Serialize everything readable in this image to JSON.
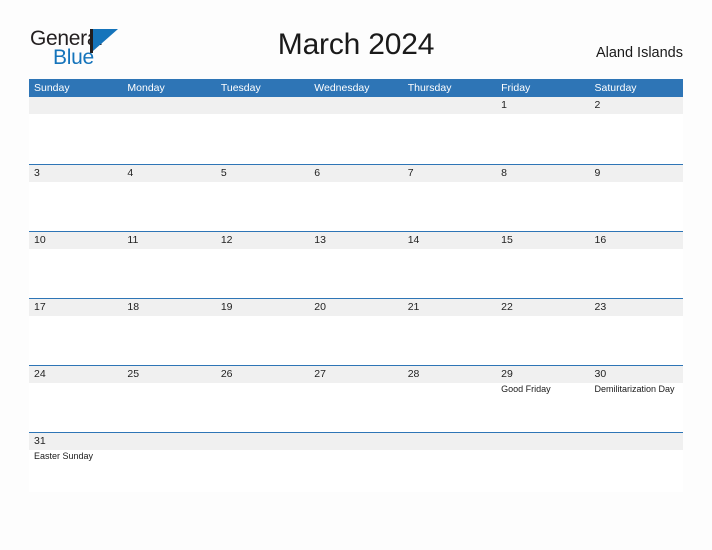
{
  "brand": {
    "word_one": "General",
    "word_two": "Blue",
    "mark": "flag-triangle",
    "color_dark": "#231f20",
    "color_blue": "#1574bb"
  },
  "header": {
    "title": "March 2024",
    "location": "Aland Islands"
  },
  "theme": {
    "header_blue": "#2e75b6",
    "row_band_gray": "#f0f0f0",
    "page_background": "#fdfdfd"
  },
  "weekdays": [
    "Sunday",
    "Monday",
    "Tuesday",
    "Wednesday",
    "Thursday",
    "Friday",
    "Saturday"
  ],
  "weeks": [
    {
      "days": [
        {
          "num": "",
          "events": []
        },
        {
          "num": "",
          "events": []
        },
        {
          "num": "",
          "events": []
        },
        {
          "num": "",
          "events": []
        },
        {
          "num": "",
          "events": []
        },
        {
          "num": "1",
          "events": []
        },
        {
          "num": "2",
          "events": []
        }
      ]
    },
    {
      "days": [
        {
          "num": "3",
          "events": []
        },
        {
          "num": "4",
          "events": []
        },
        {
          "num": "5",
          "events": []
        },
        {
          "num": "6",
          "events": []
        },
        {
          "num": "7",
          "events": []
        },
        {
          "num": "8",
          "events": []
        },
        {
          "num": "9",
          "events": []
        }
      ]
    },
    {
      "days": [
        {
          "num": "10",
          "events": []
        },
        {
          "num": "11",
          "events": []
        },
        {
          "num": "12",
          "events": []
        },
        {
          "num": "13",
          "events": []
        },
        {
          "num": "14",
          "events": []
        },
        {
          "num": "15",
          "events": []
        },
        {
          "num": "16",
          "events": []
        }
      ]
    },
    {
      "days": [
        {
          "num": "17",
          "events": []
        },
        {
          "num": "18",
          "events": []
        },
        {
          "num": "19",
          "events": []
        },
        {
          "num": "20",
          "events": []
        },
        {
          "num": "21",
          "events": []
        },
        {
          "num": "22",
          "events": []
        },
        {
          "num": "23",
          "events": []
        }
      ]
    },
    {
      "days": [
        {
          "num": "24",
          "events": []
        },
        {
          "num": "25",
          "events": []
        },
        {
          "num": "26",
          "events": []
        },
        {
          "num": "27",
          "events": []
        },
        {
          "num": "28",
          "events": []
        },
        {
          "num": "29",
          "events": [
            "Good Friday"
          ]
        },
        {
          "num": "30",
          "events": [
            "Demilitarization Day"
          ]
        }
      ]
    },
    {
      "days": [
        {
          "num": "31",
          "events": [
            "Easter Sunday"
          ]
        },
        {
          "num": "",
          "events": []
        },
        {
          "num": "",
          "events": []
        },
        {
          "num": "",
          "events": []
        },
        {
          "num": "",
          "events": []
        },
        {
          "num": "",
          "events": []
        },
        {
          "num": "",
          "events": []
        }
      ]
    }
  ]
}
